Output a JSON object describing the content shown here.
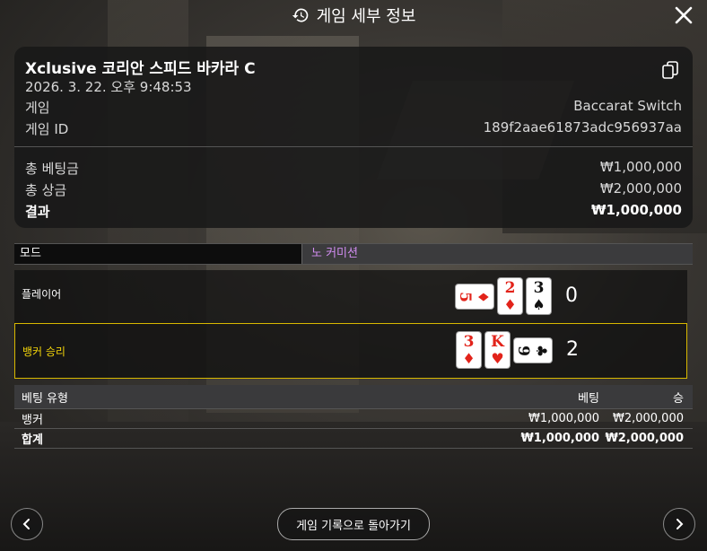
{
  "header": {
    "title": "게임 세부 정보",
    "history_icon": "history-icon",
    "close_icon": "close-icon"
  },
  "game": {
    "name": "Xclusive 코리안 스피드 바카라 C",
    "datetime": "2026. 3. 22. 오후 9:48:53",
    "game_label": "게임",
    "game_value": "Baccarat Switch",
    "id_label": "게임 ID",
    "id_value": "189f2aae61873adc956937aa",
    "total_bet_label": "총 베팅금",
    "total_bet_value": "₩1,000,000",
    "total_win_label": "총 상금",
    "total_win_value": "₩2,000,000",
    "result_label": "결과",
    "result_value": "₩1,000,000"
  },
  "mode": {
    "label": "모드",
    "value": "노 커미션"
  },
  "player": {
    "label": "플레이어",
    "score": "0",
    "cards": [
      {
        "rank": "5",
        "suit": "♦",
        "color": "red",
        "orientation": "side"
      },
      {
        "rank": "2",
        "suit": "♦",
        "color": "red",
        "orientation": "up"
      },
      {
        "rank": "3",
        "suit": "♠",
        "color": "black",
        "orientation": "up"
      }
    ]
  },
  "banker": {
    "label": "뱅커 승리",
    "score": "2",
    "cards": [
      {
        "rank": "3",
        "suit": "♦",
        "color": "red",
        "orientation": "up"
      },
      {
        "rank": "K",
        "suit": "♥",
        "color": "red",
        "orientation": "up"
      },
      {
        "rank": "9",
        "suit": "♣",
        "color": "black",
        "orientation": "side"
      }
    ]
  },
  "bets": {
    "headers": {
      "type": "베팅 유형",
      "bet": "베팅",
      "win": "승"
    },
    "rows": [
      {
        "type": "뱅커",
        "bet": "₩1,000,000",
        "win": "₩2,000,000"
      }
    ],
    "total": {
      "type": "합계",
      "bet": "₩1,000,000",
      "win": "₩2,000,000"
    }
  },
  "footer": {
    "back_label": "게임 기록으로 돌아가기",
    "prev_icon": "chevron-left-icon",
    "next_icon": "chevron-right-icon"
  },
  "colors": {
    "mode_value": "#d18cf0",
    "banker_highlight": "#f2d40a",
    "card_red": "#e2231a"
  }
}
